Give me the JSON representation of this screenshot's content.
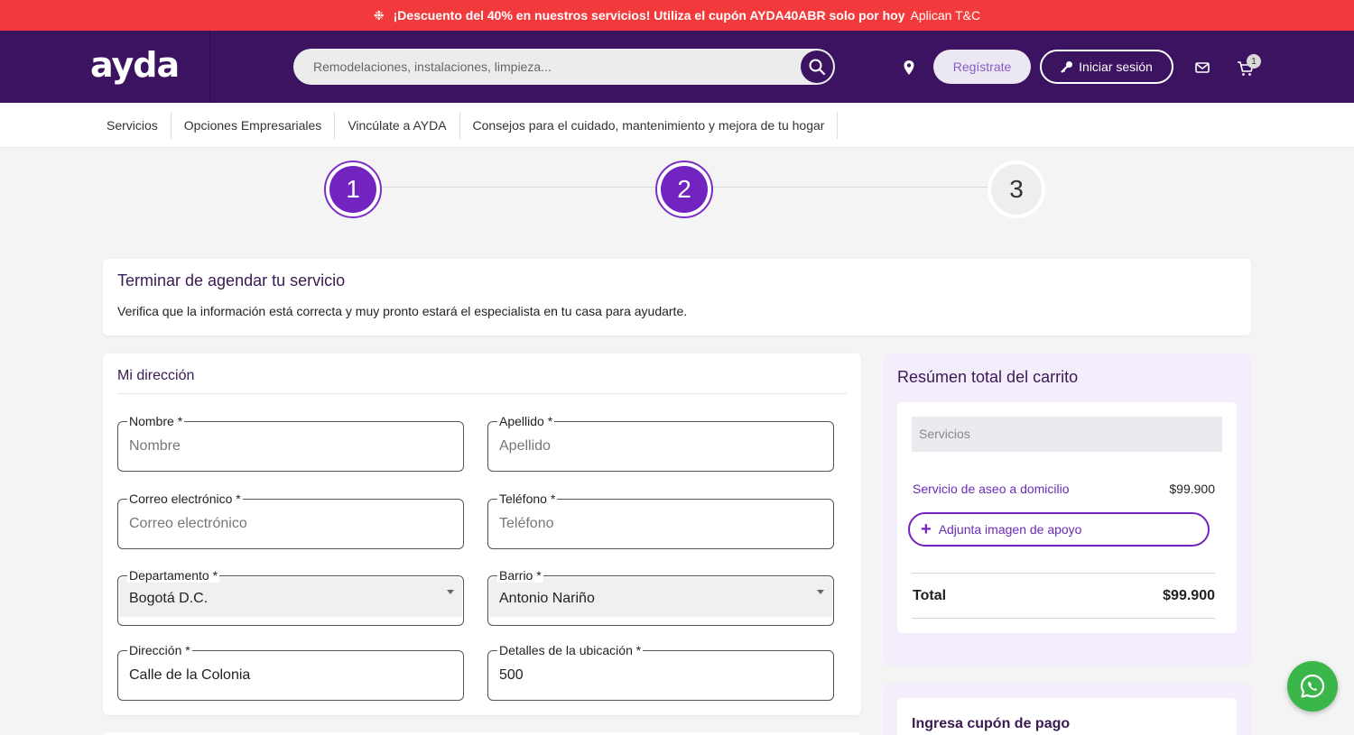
{
  "promo": {
    "bold_text": "¡Descuento del 40% en nuestros servicios! Utiliza el cupón AYDA40ABR solo por hoy",
    "terms": "Aplican T&C",
    "icon": "gear-icon"
  },
  "header": {
    "logo": "ayda",
    "search_placeholder": "Remodelaciones, instalaciones, limpieza...",
    "register_label": "Regístrate",
    "login_label": "Iniciar sesión",
    "cart_count": "1",
    "colors": {
      "header_bg": "#3c1361",
      "promo_bg": "#f23a3c",
      "accent": "#7223c0"
    }
  },
  "nav": {
    "items": [
      {
        "label": "Servicios"
      },
      {
        "label": "Opciones Empresariales"
      },
      {
        "label": "Vincúlate a AYDA"
      },
      {
        "label": "Consejos para el cuidado, mantenimiento y mejora de tu hogar"
      }
    ]
  },
  "stepper": {
    "steps": [
      {
        "label": "1",
        "state": "done"
      },
      {
        "label": "2",
        "state": "active"
      },
      {
        "label": "3",
        "state": "pending"
      }
    ]
  },
  "intro": {
    "title": "Terminar de agendar tu servicio",
    "text": "Verifica que la información está correcta y muy pronto estará el especialista en tu casa para ayudarte."
  },
  "address": {
    "title": "Mi dirección",
    "required_mark": "*",
    "fields": {
      "nombre": {
        "label": "Nombre",
        "placeholder": "Nombre",
        "value": ""
      },
      "apellido": {
        "label": "Apellido",
        "placeholder": "Apellido",
        "value": ""
      },
      "correo": {
        "label": "Correo electrónico",
        "placeholder": "Correo electrónico",
        "value": ""
      },
      "telefono": {
        "label": "Teléfono",
        "placeholder": "Teléfono",
        "value": ""
      },
      "departamento": {
        "label": "Departamento",
        "value": "Bogotá D.C."
      },
      "barrio": {
        "label": "Barrio",
        "value": "Antonio Nariño"
      },
      "direccion": {
        "label": "Dirección",
        "value": "Calle de la Colonia"
      },
      "detalles": {
        "label": "Detalles de la ubicación",
        "value": "500"
      }
    }
  },
  "summary": {
    "title": "Resúmen total del carrito",
    "section_header": "Servicios",
    "item_name": "Servicio de aseo a domicilio",
    "item_price": "$99.900",
    "attach_label": "Adjunta imagen de apoyo",
    "total_label": "Total",
    "total_value": "$99.900"
  },
  "coupon": {
    "title": "Ingresa cupón de pago"
  }
}
